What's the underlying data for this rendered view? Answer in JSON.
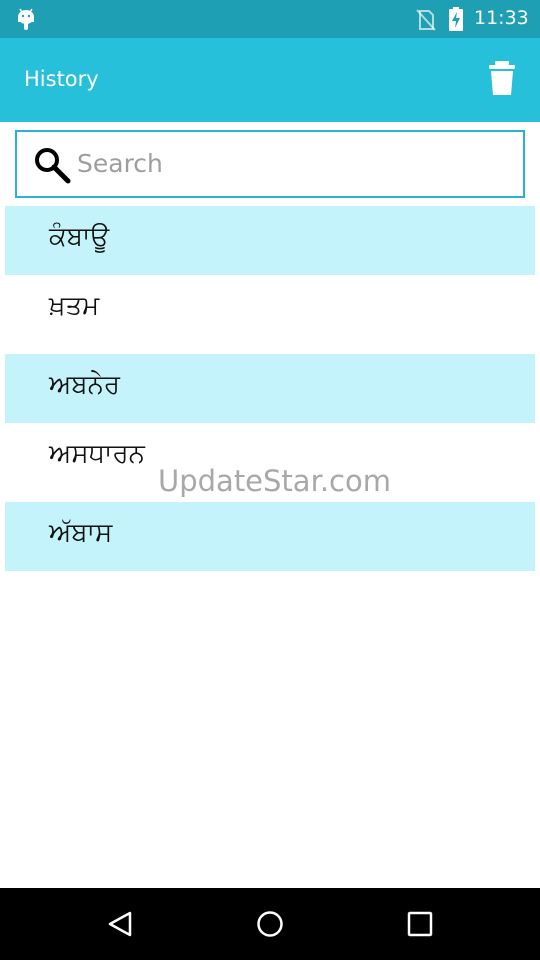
{
  "status_bar": {
    "time": "11:33",
    "icons": [
      "android-icon",
      "no-sim-icon",
      "battery-charging-icon"
    ]
  },
  "app_bar": {
    "title": "History",
    "action_icon": "trash-icon"
  },
  "search": {
    "placeholder": "Search",
    "value": ""
  },
  "history": {
    "items": [
      {
        "label": "ਕੰਬਾਊ"
      },
      {
        "label": "ਖ਼ਤਮ"
      },
      {
        "label": "ਅਬਨੇਰ"
      },
      {
        "label": "ਅਸਧਾਰਨ"
      },
      {
        "label": "ਅੱਬਾਸ"
      }
    ]
  },
  "watermark": "UpdateStar.com",
  "colors": {
    "status_bar": "#1e9fb3",
    "app_bar": "#26c0da",
    "row_highlight": "#c4f3fb",
    "search_border": "#26b5cc"
  },
  "nav_bar": {
    "buttons": [
      "back-icon",
      "home-icon",
      "recents-icon"
    ]
  }
}
